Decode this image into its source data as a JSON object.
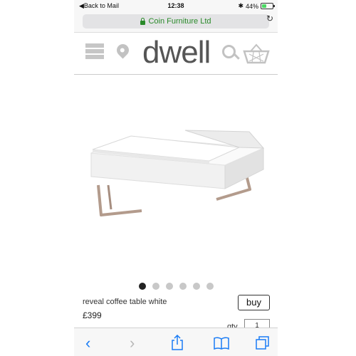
{
  "status_bar": {
    "back_label": "Back to Mail",
    "time": "12:38",
    "battery": "44%",
    "battery_level": 0.44
  },
  "browser": {
    "url": "Coin Furniture Ltd"
  },
  "site": {
    "logo": "dwell"
  },
  "product": {
    "name": "reveal coffee table white",
    "price": "£399",
    "buy_label": "buy",
    "qty_label": "qty",
    "qty_value": "1",
    "image_count": 6,
    "active_image": 0
  },
  "colors": {
    "accent": "#1a7cf5",
    "secure": "#2a8a2a"
  }
}
